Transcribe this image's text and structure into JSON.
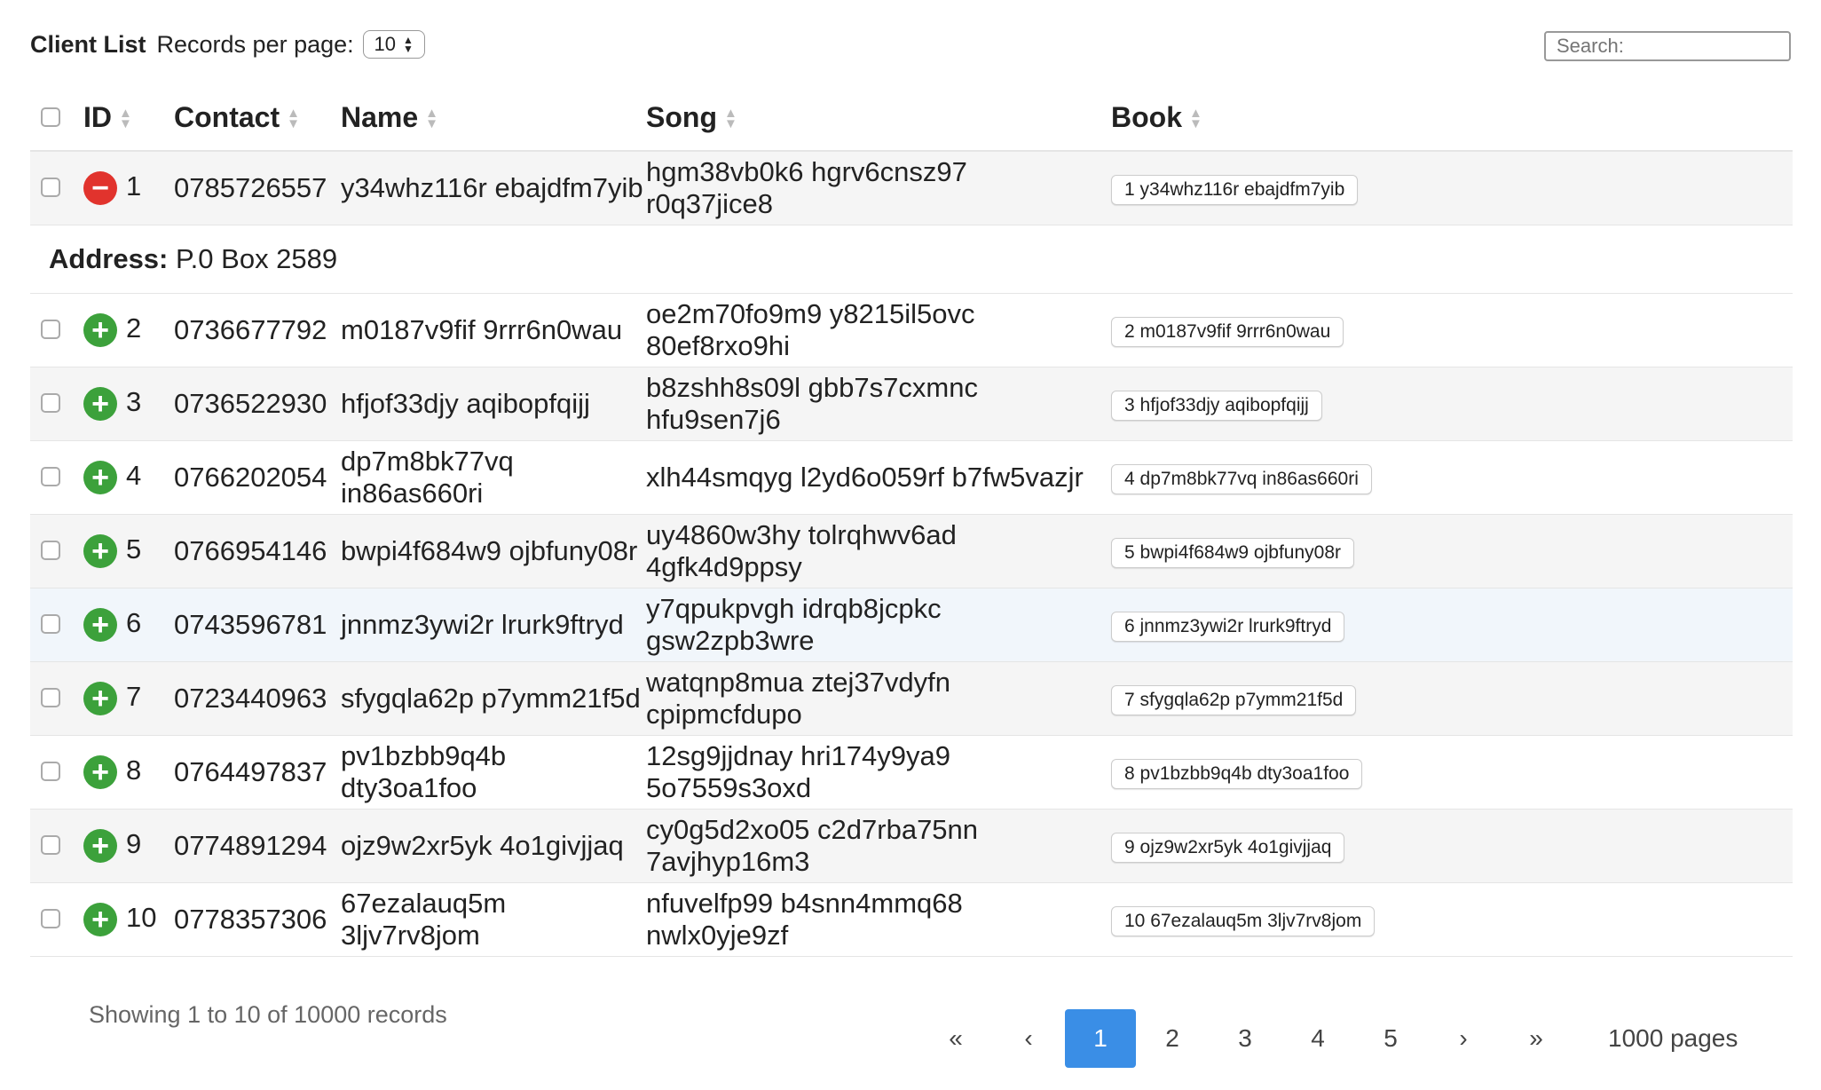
{
  "header": {
    "title": "Client List",
    "rpp_label": "Records per page:",
    "rpp_value": "10"
  },
  "search": {
    "placeholder": "Search:"
  },
  "columns": {
    "id": "ID",
    "contact": "Contact",
    "name": "Name",
    "song": "Song",
    "book": "Book"
  },
  "rows": [
    {
      "id": "1",
      "contact": "0785726557",
      "name": "y34whz116r ebajdfm7yib",
      "song": "hgm38vb0k6 hgrv6cnsz97 r0q37jice8",
      "book": "1 y34whz116r ebajdfm7yib",
      "expanded": true
    },
    {
      "id": "2",
      "contact": "0736677792",
      "name": "m0187v9fif 9rrr6n0wau",
      "song": "oe2m70fo9m9 y8215il5ovc 80ef8rxo9hi",
      "book": "2 m0187v9fif 9rrr6n0wau"
    },
    {
      "id": "3",
      "contact": "0736522930",
      "name": "hfjof33djy aqibopfqijj",
      "song": "b8zshh8s09l gbb7s7cxmnc hfu9sen7j6",
      "book": "3 hfjof33djy aqibopfqijj"
    },
    {
      "id": "4",
      "contact": "0766202054",
      "name": "dp7m8bk77vq in86as660ri",
      "song": "xlh44smqyg l2yd6o059rf b7fw5vazjr",
      "book": "4 dp7m8bk77vq in86as660ri"
    },
    {
      "id": "5",
      "contact": "0766954146",
      "name": "bwpi4f684w9 ojbfuny08r",
      "song": "uy4860w3hy tolrqhwv6ad 4gfk4d9ppsy",
      "book": "5 bwpi4f684w9 ojbfuny08r"
    },
    {
      "id": "6",
      "contact": "0743596781",
      "name": "jnnmz3ywi2r lrurk9ftryd",
      "song": "y7qpukpvgh idrqb8jcpkc gsw2zpb3wre",
      "book": "6 jnnmz3ywi2r lrurk9ftryd"
    },
    {
      "id": "7",
      "contact": "0723440963",
      "name": "sfygqla62p p7ymm21f5d",
      "song": "watqnp8mua ztej37vdyfn cpipmcfdupo",
      "book": "7 sfygqla62p p7ymm21f5d"
    },
    {
      "id": "8",
      "contact": "0764497837",
      "name": "pv1bzbb9q4b dty3oa1foo",
      "song": "12sg9jjdnay hri174y9ya9 5o7559s3oxd",
      "book": "8 pv1bzbb9q4b dty3oa1foo"
    },
    {
      "id": "9",
      "contact": "0774891294",
      "name": "ojz9w2xr5yk 4o1givjjaq",
      "song": "cy0g5d2xo05 c2d7rba75nn 7avjhyp16m3",
      "book": "9 ojz9w2xr5yk 4o1givjjaq"
    },
    {
      "id": "10",
      "contact": "0778357306",
      "name": "67ezalauq5m 3ljv7rv8jom",
      "song": "nfuvelfp99 b4snn4mmq68 nwlx0yje9zf",
      "book": "10 67ezalauq5m 3ljv7rv8jom"
    }
  ],
  "detail": {
    "address_label": "Address:",
    "address_value": "P.0 Box 2589"
  },
  "footer": {
    "info": "Showing 1 to 10 of 10000 records",
    "total_pages": "1000 pages"
  },
  "pagination": {
    "first": "«",
    "prev": "‹",
    "pages": [
      "1",
      "2",
      "3",
      "4",
      "5"
    ],
    "next": "›",
    "last": "»",
    "active": "1"
  },
  "icons": {
    "sort": "sort-icon",
    "expand": "plus-circle-icon",
    "collapse": "minus-circle-icon"
  },
  "colors": {
    "accent": "#3a8ee6",
    "plus": "#3ca13b",
    "minus": "#e1332d",
    "row_stripe": "#f5f5f5",
    "row_hover": "#f1f6fb"
  }
}
